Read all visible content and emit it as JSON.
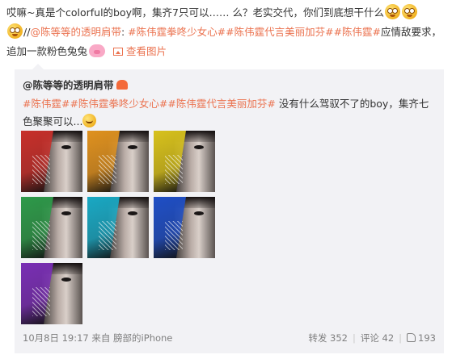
{
  "post": {
    "text_1": "哎嘛~真是个colorful的boy啊，集齐7只可以…… 么？老实交代，你们到底想干什么",
    "text_2": "//",
    "mention": "@陈等等的透明肩带",
    "text_3": ":",
    "tag_1": "#陈伟霆拳咚少女心#",
    "tag_2": "#陈伟霆代言美丽加芬#",
    "tag_3": "#陈伟霆#",
    "text_4": "应情敌要求，追加一款粉色兔兔",
    "view_image_label": "查看图片"
  },
  "repost": {
    "author": "@陈等等的透明肩带",
    "tag_1": "#陈伟霆#",
    "tag_2": "#陈伟霆拳咚少女心#",
    "tag_3": "#陈伟霆代言美丽加芬#",
    "text": " 没有什么驾驭不了的boy，集齐七色聚聚可以...",
    "images": [
      {
        "color": "#c8302b"
      },
      {
        "color": "#e0921f"
      },
      {
        "color": "#d8c21c"
      },
      {
        "color": "#2e9a4a"
      },
      {
        "color": "#1aa9c4"
      },
      {
        "color": "#1f4fc6"
      },
      {
        "color": "#7a2fb5"
      }
    ],
    "footer": {
      "date": "10月8日 19:17",
      "source_prefix": "来自",
      "source": "膀部的iPhone",
      "repost_label": "转发",
      "repost_count": "352",
      "comment_label": "评论",
      "comment_count": "42",
      "like_count": "193"
    }
  },
  "icons": {
    "emoji": "sweat-smile-emoji",
    "pig": "pink-pig-emoji",
    "image": "image-icon",
    "like": "thumbs-up-icon"
  }
}
